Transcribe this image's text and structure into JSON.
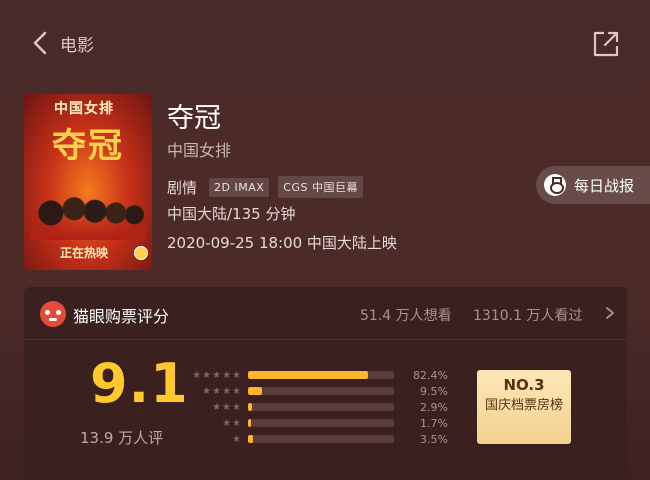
{
  "nav": {
    "title": "电影"
  },
  "poster": {
    "tagline": "中国女排",
    "big_title": "夺冠",
    "status_text": "正在热映"
  },
  "movie": {
    "title": "夺冠",
    "subtitle": "中国女排",
    "genre": "剧情",
    "badges": [
      "2D IMAX",
      "CGS 中国巨幕"
    ],
    "region_duration": "中国大陆/135 分钟",
    "release": "2020-09-25 18:00 中国大陆上映"
  },
  "daily_report": {
    "label": "每日战报"
  },
  "rating": {
    "header_title": "猫眼购票评分",
    "want_to_see": "51.4 万人想看",
    "have_seen": "1310.1 万人看过",
    "score": "9.1",
    "rating_count": "13.9 万人评",
    "distribution": [
      {
        "stars": "★★★★★",
        "pct_label": "82.4%",
        "value": 82.4
      },
      {
        "stars": "★★★★",
        "pct_label": "9.5%",
        "value": 9.5
      },
      {
        "stars": "★★★",
        "pct_label": "2.9%",
        "value": 2.9
      },
      {
        "stars": "★★",
        "pct_label": "1.7%",
        "value": 1.7
      },
      {
        "stars": "★",
        "pct_label": "3.5%",
        "value": 3.5
      }
    ],
    "rank_no": "NO.3",
    "rank_label": "国庆档票房榜"
  },
  "colors": {
    "accent": "#ffc82c",
    "bar": "#ffb62a",
    "background": "#4a2a28"
  },
  "icons": {
    "back": "chevron-left-icon",
    "share": "share-icon",
    "daily": "medal-icon",
    "brand": "maoyan-cat-icon",
    "more": "chevron-right-icon"
  }
}
